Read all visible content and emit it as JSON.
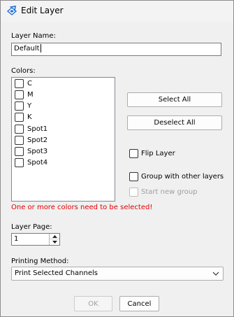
{
  "window": {
    "title": "Edit Layer"
  },
  "layer_name": {
    "label": "Layer Name:",
    "value": "Default"
  },
  "colors": {
    "label": "Colors:",
    "items": [
      {
        "label": "C",
        "checked": false
      },
      {
        "label": "M",
        "checked": false
      },
      {
        "label": "Y",
        "checked": false
      },
      {
        "label": "K",
        "checked": false
      },
      {
        "label": "Spot1",
        "checked": false
      },
      {
        "label": "Spot2",
        "checked": false
      },
      {
        "label": "Spot3",
        "checked": false
      },
      {
        "label": "Spot4",
        "checked": false
      }
    ],
    "select_all": "Select All",
    "deselect_all": "Deselect All",
    "error": "One or more colors need to be selected!"
  },
  "options": {
    "flip_layer": {
      "label": "Flip Layer",
      "checked": false
    },
    "group_with_others": {
      "label": "Group with other layers",
      "checked": false
    },
    "start_new_group": {
      "label": "Start new group",
      "checked": false,
      "enabled": false
    }
  },
  "layer_page": {
    "label": "Layer Page:",
    "value": "1"
  },
  "printing_method": {
    "label": "Printing Method:",
    "value": "Print Selected Channels"
  },
  "buttons": {
    "ok": "OK",
    "cancel": "Cancel"
  },
  "colors_theme": {
    "error_text": "#e00000",
    "icon_accent": "#1e6fd9"
  },
  "icons": {
    "app": "layer-app-icon",
    "spinner": "spinner-arrows-icon",
    "dropdown": "chevron-down-icon"
  }
}
